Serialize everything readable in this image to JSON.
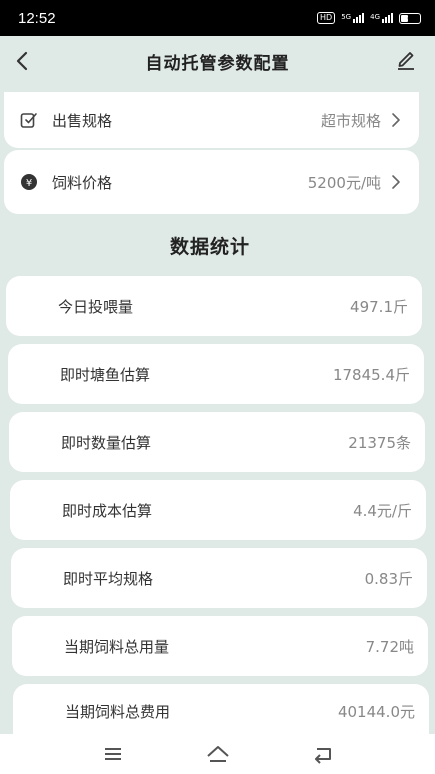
{
  "status_bar": {
    "time": "12:52",
    "hd": "HD",
    "net1": "5G",
    "net2": "4G",
    "battery": "6"
  },
  "nav": {
    "title": "自动托管参数配置",
    "back_icon": "chevron-left-icon",
    "edit_icon": "pencil-icon"
  },
  "config": [
    {
      "label": "出售规格",
      "value": "超市规格",
      "icon": "checkbox-edit-icon"
    },
    {
      "label": "饲料价格",
      "value": "5200元/吨",
      "icon": "yen-icon"
    }
  ],
  "stats_title": "数据统计",
  "stats": [
    {
      "label": "今日投喂量",
      "value": "497.1斤"
    },
    {
      "label": "即时塘鱼估算",
      "value": "17845.4斤"
    },
    {
      "label": "即时数量估算",
      "value": "21375条"
    },
    {
      "label": "即时成本估算",
      "value": "4.4元/斤"
    },
    {
      "label": "即时平均规格",
      "value": "0.83斤"
    },
    {
      "label": "当期饲料总用量",
      "value": "7.72吨"
    },
    {
      "label": "当期饲料总费用",
      "value": "40144.0元"
    }
  ],
  "colors": {
    "background": "#dfe9e5",
    "card": "#ffffff",
    "text": "#333333",
    "muted": "#888888"
  }
}
